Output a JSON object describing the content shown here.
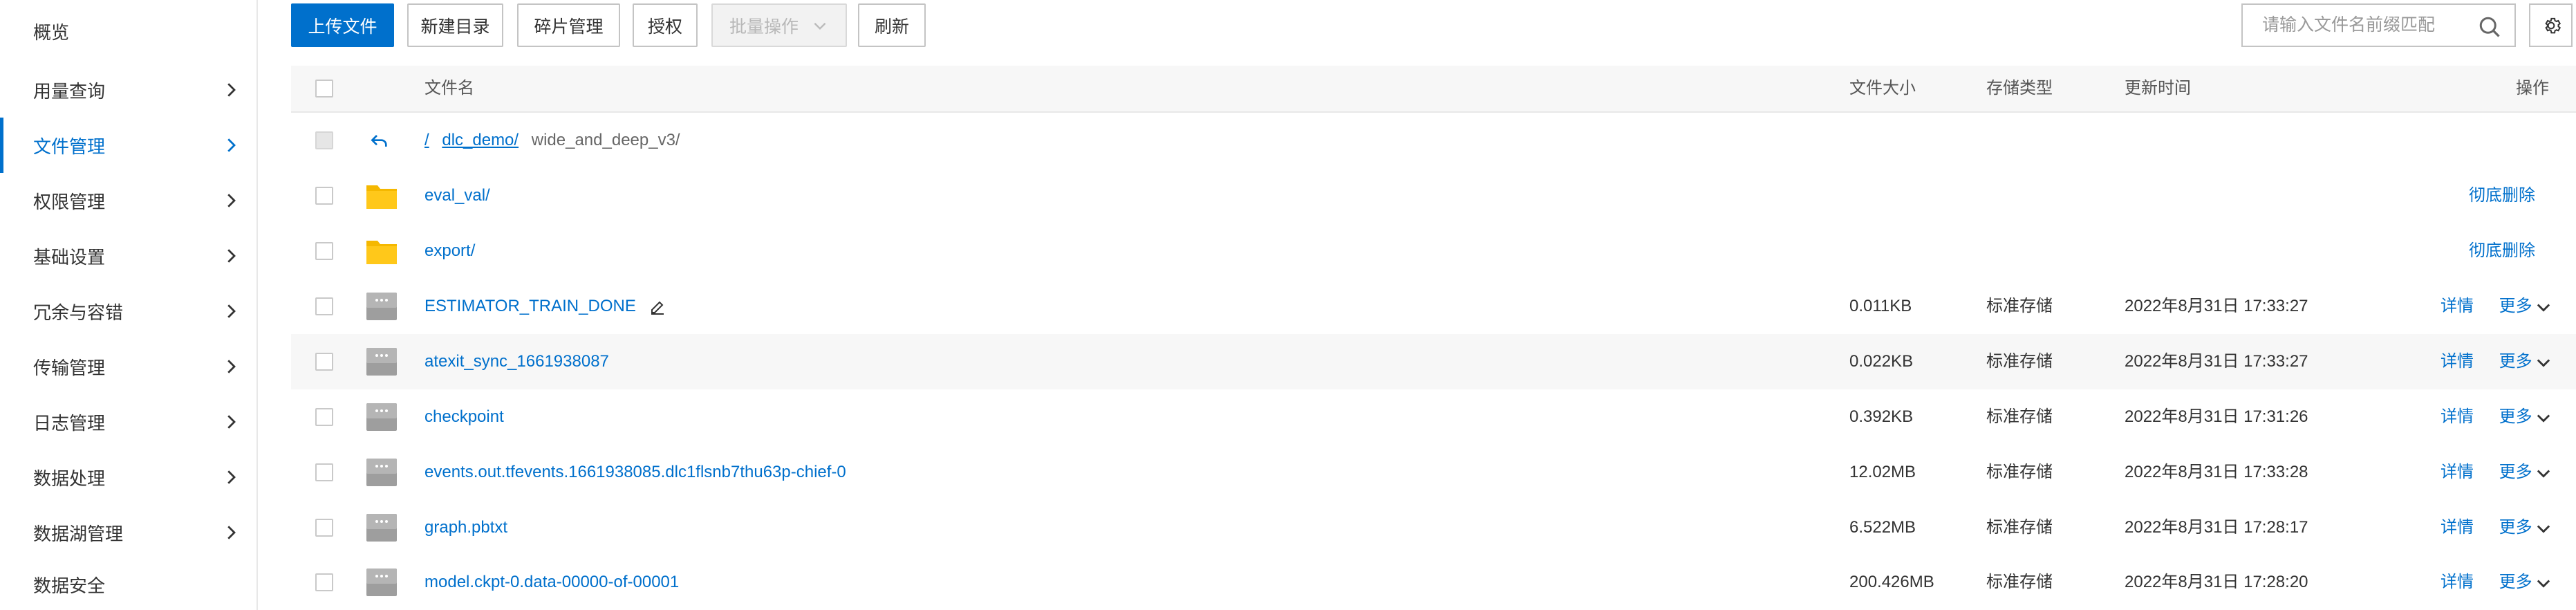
{
  "sidebar": {
    "items": [
      {
        "label": "概览",
        "has_arrow": false,
        "active": false
      },
      {
        "label": "用量查询",
        "has_arrow": true,
        "active": false
      },
      {
        "label": "文件管理",
        "has_arrow": true,
        "active": true
      },
      {
        "label": "权限管理",
        "has_arrow": true,
        "active": false
      },
      {
        "label": "基础设置",
        "has_arrow": true,
        "active": false
      },
      {
        "label": "冗余与容错",
        "has_arrow": true,
        "active": false
      },
      {
        "label": "传输管理",
        "has_arrow": true,
        "active": false
      },
      {
        "label": "日志管理",
        "has_arrow": true,
        "active": false
      },
      {
        "label": "数据处理",
        "has_arrow": true,
        "active": false
      },
      {
        "label": "数据湖管理",
        "has_arrow": true,
        "active": false
      },
      {
        "label": "数据安全",
        "has_arrow": false,
        "active": false
      }
    ]
  },
  "toolbar": {
    "upload": "上传文件",
    "new_dir": "新建目录",
    "fragments": "碎片管理",
    "authorize": "授权",
    "batch": "批量操作",
    "refresh": "刷新",
    "search_placeholder": "请输入文件名前缀匹配",
    "accent_color": "#0070cc"
  },
  "table": {
    "headers": {
      "name": "文件名",
      "size": "文件大小",
      "storage": "存储类型",
      "updated": "更新时间",
      "actions": "操作"
    },
    "breadcrumb": {
      "root": "/",
      "dir1": "dlc_demo/",
      "current": "wide_and_deep_v3/"
    },
    "folders": [
      {
        "name": "eval_val/",
        "action": "彻底删除"
      },
      {
        "name": "export/",
        "action": "彻底删除"
      }
    ],
    "files": [
      {
        "name": "ESTIMATOR_TRAIN_DONE",
        "size": "0.011KB",
        "storage": "标准存储",
        "updated": "2022年8月31日 17:33:27",
        "detail": "详情",
        "more": "更多"
      },
      {
        "name": "atexit_sync_1661938087",
        "size": "0.022KB",
        "storage": "标准存储",
        "updated": "2022年8月31日 17:33:27",
        "detail": "详情",
        "more": "更多"
      },
      {
        "name": "checkpoint",
        "size": "0.392KB",
        "storage": "标准存储",
        "updated": "2022年8月31日 17:31:26",
        "detail": "详情",
        "more": "更多"
      },
      {
        "name": "events.out.tfevents.1661938085.dlc1flsnb7thu63p-chief-0",
        "size": "12.02MB",
        "storage": "标准存储",
        "updated": "2022年8月31日 17:33:28",
        "detail": "详情",
        "more": "更多"
      },
      {
        "name": "graph.pbtxt",
        "size": "6.522MB",
        "storage": "标准存储",
        "updated": "2022年8月31日 17:28:17",
        "detail": "详情",
        "more": "更多"
      },
      {
        "name": "model.ckpt-0.data-00000-of-00001",
        "size": "200.426MB",
        "storage": "标准存储",
        "updated": "2022年8月31日 17:28:20",
        "detail": "详情",
        "more": "更多"
      }
    ]
  }
}
